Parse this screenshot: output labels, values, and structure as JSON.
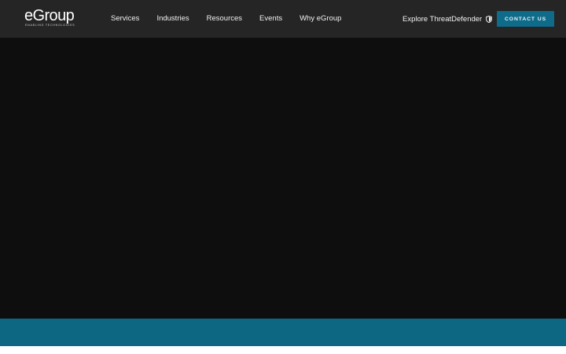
{
  "logo": {
    "wordmark": "eGroup",
    "tagline": "ENABLING TECHNOLOGIES"
  },
  "nav": {
    "items": [
      {
        "label": "Services"
      },
      {
        "label": "Industries"
      },
      {
        "label": "Resources"
      },
      {
        "label": "Events"
      },
      {
        "label": "Why eGroup"
      }
    ]
  },
  "header_actions": {
    "explore_label": "Explore ThreatDefender",
    "explore_icon": "shield-icon",
    "contact_label": "CONTACT US"
  },
  "colors": {
    "header_bg": "#252525",
    "hero_bg": "#0e0e0e",
    "accent_teal": "#0d6783",
    "button_teal": "#0e6b8a"
  }
}
